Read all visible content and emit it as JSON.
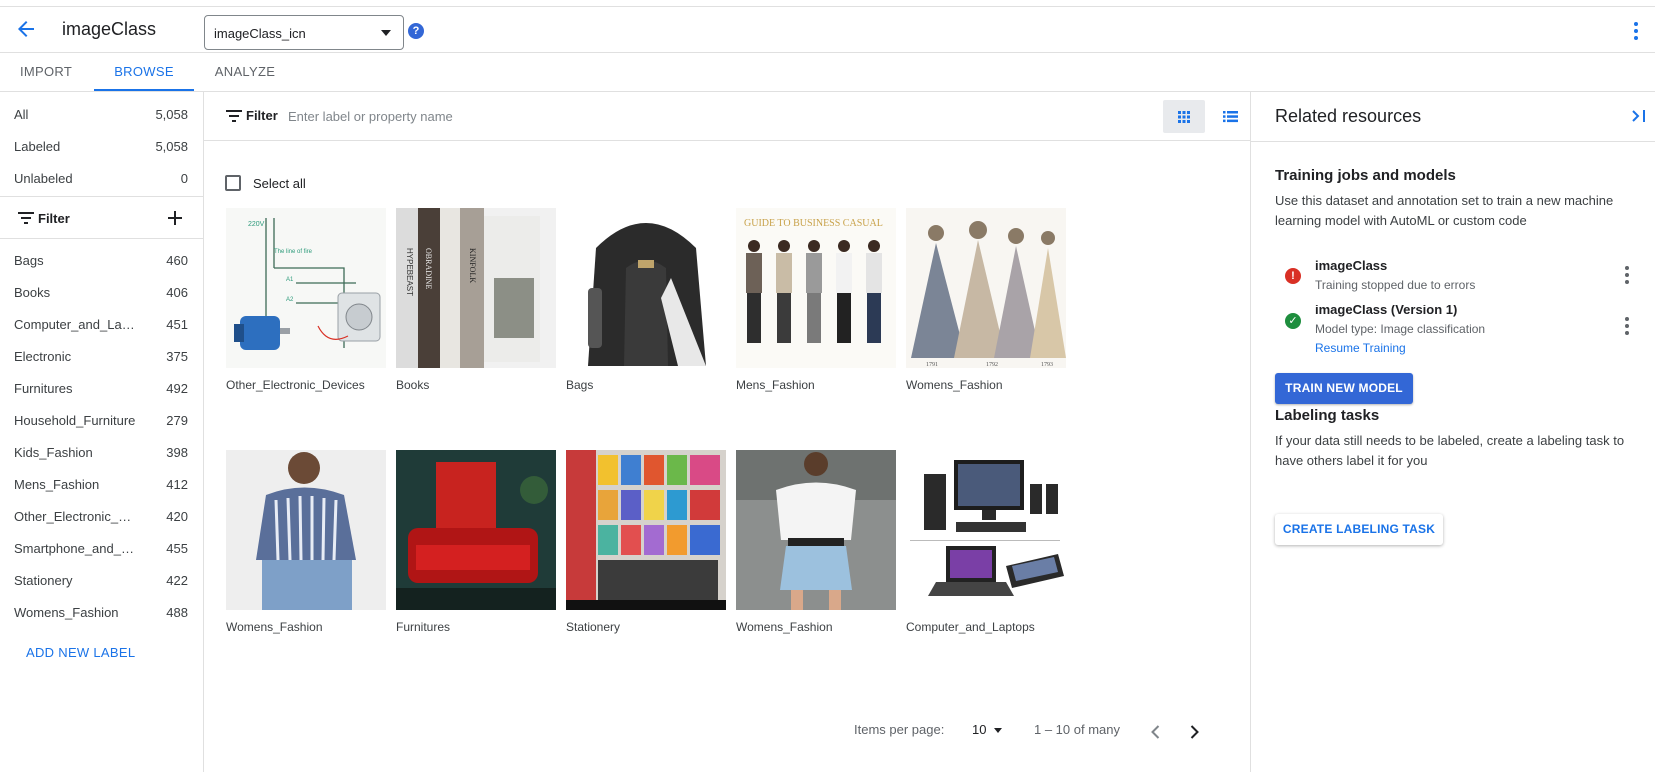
{
  "header": {
    "app_title": "imageClass",
    "annotation_set": "imageClass_icn",
    "help_icon": "help-circle-icon",
    "back_icon": "arrow-back-icon",
    "more_icon": "more-vert-icon"
  },
  "tabs": [
    {
      "label": "IMPORT",
      "active": false
    },
    {
      "label": "BROWSE",
      "active": true
    },
    {
      "label": "ANALYZE",
      "active": false
    }
  ],
  "sidebar": {
    "summary": [
      {
        "label": "All",
        "count": "5,058"
      },
      {
        "label": "Labeled",
        "count": "5,058"
      },
      {
        "label": "Unlabeled",
        "count": "0"
      }
    ],
    "filter_label": "Filter",
    "labels": [
      {
        "label": "Bags",
        "count": "460"
      },
      {
        "label": "Books",
        "count": "406"
      },
      {
        "label": "Computer_and_Laptops",
        "count": "451"
      },
      {
        "label": "Electronic",
        "count": "375"
      },
      {
        "label": "Furnitures",
        "count": "492"
      },
      {
        "label": "Household_Furniture",
        "count": "279"
      },
      {
        "label": "Kids_Fashion",
        "count": "398"
      },
      {
        "label": "Mens_Fashion",
        "count": "412"
      },
      {
        "label": "Other_Electronic_Devices",
        "count": "420"
      },
      {
        "label": "Smartphone_and_Accessories",
        "count": "455"
      },
      {
        "label": "Stationery",
        "count": "422"
      },
      {
        "label": "Womens_Fashion",
        "count": "488"
      }
    ],
    "add_label": "ADD NEW LABEL"
  },
  "main": {
    "filter_label": "Filter",
    "filter_placeholder": "Enter label or property name",
    "select_all": "Select all",
    "images": [
      {
        "caption": "Other_Electronic_Devices"
      },
      {
        "caption": "Books"
      },
      {
        "caption": "Bags"
      },
      {
        "caption": "Mens_Fashion"
      },
      {
        "caption": "Womens_Fashion"
      },
      {
        "caption": "Womens_Fashion"
      },
      {
        "caption": "Furnitures"
      },
      {
        "caption": "Stationery"
      },
      {
        "caption": "Womens_Fashion"
      },
      {
        "caption": "Computer_and_Laptops"
      }
    ],
    "pager": {
      "items_per_page_label": "Items per page:",
      "items_per_page": "10",
      "range": "1 – 10 of many"
    }
  },
  "right_panel": {
    "title": "Related resources",
    "training": {
      "title": "Training jobs and models",
      "desc": "Use this dataset and annotation set to train a new machine learning model with AutoML or custom code",
      "jobs": [
        {
          "name": "imageClass",
          "status": "Training stopped due to errors",
          "state": "error"
        },
        {
          "name": "imageClass (Version 1)",
          "status": "Model type: Image classification",
          "link": "Resume Training",
          "state": "success"
        }
      ],
      "button": "TRAIN NEW MODEL"
    },
    "labeling": {
      "title": "Labeling tasks",
      "desc": "If your data still needs to be labeled, create a labeling task to have others label it for you",
      "button": "CREATE LABELING TASK"
    }
  },
  "colors": {
    "accent": "#1a73e8",
    "primary_button": "#3367d6",
    "error": "#d93025",
    "success": "#1e8e3e"
  }
}
